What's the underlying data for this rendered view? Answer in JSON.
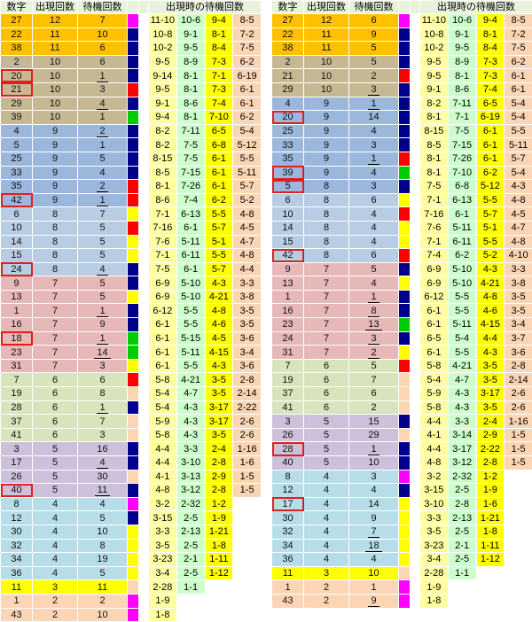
{
  "headers": [
    "数字",
    "出現回数",
    "待機回数",
    "",
    "",
    "出現時の待機回数",
    "",
    "",
    ""
  ],
  "colors": {
    "orange": "#ffc000",
    "tan": "#c5b893",
    "blue": "#9bb7dc",
    "lightblue": "#b8cce4",
    "pink": "#e6b8b7",
    "sage": "#d8e4bc",
    "lavender": "#ccc0da",
    "cyan": "#b7dee8",
    "peach": "#fcd5b4",
    "yellow": "#ffff00",
    "highlight": "#e0201b"
  },
  "left": [
    {
      "g": "orange",
      "h": false,
      "u": false,
      "b": "magenta",
      "cells": [
        "27",
        "12",
        "7",
        "11-10",
        "10-6",
        "9-4",
        "8-5"
      ]
    },
    {
      "g": "orange",
      "h": false,
      "u": false,
      "b": "navy",
      "cells": [
        "22",
        "11",
        "10",
        "10-8",
        "9-1",
        "8-1",
        "7-2"
      ]
    },
    {
      "g": "orange",
      "h": false,
      "u": false,
      "b": "navy",
      "cells": [
        "38",
        "11",
        "6",
        "10-2",
        "9-5",
        "8-4",
        "7-5"
      ]
    },
    {
      "g": "tan",
      "h": false,
      "u": false,
      "b": "navy",
      "cells": [
        "2",
        "10",
        "6",
        "9-5",
        "8-9",
        "7-3",
        "6-2"
      ]
    },
    {
      "g": "tan",
      "h": true,
      "u": true,
      "b": "navy",
      "cells": [
        "20",
        "10",
        "1",
        "9-14",
        "8-1",
        "7-1",
        "6-19"
      ]
    },
    {
      "g": "tan",
      "h": true,
      "u": false,
      "b": "red",
      "cells": [
        "21",
        "10",
        "3",
        "9-5",
        "8-1",
        "7-3",
        "6-1"
      ]
    },
    {
      "g": "tan",
      "h": false,
      "u": true,
      "b": "navy",
      "cells": [
        "29",
        "10",
        "4",
        "9-1",
        "8-6",
        "7-4",
        "6-1"
      ]
    },
    {
      "g": "tan",
      "h": false,
      "u": false,
      "b": "green",
      "cells": [
        "39",
        "10",
        "1",
        "9-4",
        "8-1",
        "7-10",
        "6-2"
      ]
    },
    {
      "g": "blue",
      "h": false,
      "u": true,
      "b": "navy",
      "cells": [
        "4",
        "9",
        "2",
        "8-2",
        "7-11",
        "6-5",
        "5-4"
      ]
    },
    {
      "g": "blue",
      "h": false,
      "u": false,
      "b": "navy",
      "cells": [
        "5",
        "9",
        "1",
        "8-2",
        "7-5",
        "6-8",
        "5-12"
      ]
    },
    {
      "g": "blue",
      "h": false,
      "u": false,
      "b": "navy",
      "cells": [
        "25",
        "9",
        "5",
        "8-15",
        "7-5",
        "6-1",
        "5-5"
      ]
    },
    {
      "g": "blue",
      "h": false,
      "u": false,
      "b": "navy",
      "cells": [
        "33",
        "9",
        "4",
        "8-5",
        "7-15",
        "6-1",
        "5-11"
      ]
    },
    {
      "g": "blue",
      "h": false,
      "u": true,
      "b": "red",
      "cells": [
        "35",
        "9",
        "2",
        "8-1",
        "7-26",
        "6-1",
        "5-7"
      ]
    },
    {
      "g": "blue",
      "h": true,
      "u": true,
      "b": "red",
      "cells": [
        "42",
        "9",
        "1",
        "8-6",
        "7-4",
        "6-2",
        "5-2"
      ]
    },
    {
      "g": "lightblue",
      "h": false,
      "u": false,
      "b": "yellow",
      "cells": [
        "6",
        "8",
        "7",
        "7-1",
        "6-13",
        "5-5",
        "4-8"
      ]
    },
    {
      "g": "lightblue",
      "h": false,
      "u": false,
      "b": "red",
      "cells": [
        "10",
        "8",
        "5",
        "7-16",
        "6-1",
        "5-7",
        "4-5"
      ]
    },
    {
      "g": "lightblue",
      "h": false,
      "u": false,
      "b": "yellow",
      "cells": [
        "14",
        "8",
        "5",
        "7-6",
        "5-11",
        "5-1",
        "4-7"
      ]
    },
    {
      "g": "lightblue",
      "h": false,
      "u": false,
      "b": "yellow",
      "cells": [
        "15",
        "8",
        "5",
        "7-1",
        "6-11",
        "5-5",
        "4-8"
      ]
    },
    {
      "g": "lightblue",
      "h": true,
      "u": true,
      "b": "navy",
      "cells": [
        "24",
        "8",
        "4",
        "7-5",
        "6-1",
        "5-7",
        "4-4"
      ]
    },
    {
      "g": "pink",
      "h": false,
      "u": false,
      "b": "navy",
      "cells": [
        "9",
        "7",
        "5",
        "6-9",
        "5-10",
        "4-3",
        "3-3"
      ]
    },
    {
      "g": "pink",
      "h": false,
      "u": false,
      "b": "yellow",
      "cells": [
        "13",
        "7",
        "5",
        "6-9",
        "5-10",
        "4-21",
        "3-8"
      ]
    },
    {
      "g": "pink",
      "h": false,
      "u": true,
      "b": "navy",
      "cells": [
        "1",
        "7",
        "1",
        "6-12",
        "5-5",
        "4-8",
        "3-5"
      ]
    },
    {
      "g": "pink",
      "h": false,
      "u": false,
      "b": "navy",
      "cells": [
        "16",
        "7",
        "9",
        "6-1",
        "5-5",
        "4-6",
        "3-5"
      ]
    },
    {
      "g": "pink",
      "h": true,
      "u": true,
      "b": "green",
      "cells": [
        "18",
        "7",
        "1",
        "6-1",
        "5-15",
        "4-5",
        "3-6"
      ]
    },
    {
      "g": "pink",
      "h": false,
      "u": true,
      "b": "green",
      "cells": [
        "23",
        "7",
        "14",
        "6-1",
        "5-11",
        "4-15",
        "3-4"
      ]
    },
    {
      "g": "pink",
      "h": false,
      "u": false,
      "b": "yellow",
      "cells": [
        "31",
        "7",
        "3",
        "6-1",
        "5-5",
        "4-3",
        "3-6"
      ]
    },
    {
      "g": "sage",
      "h": false,
      "u": false,
      "b": "red",
      "cells": [
        "7",
        "6",
        "6",
        "5-8",
        "4-21",
        "3-5",
        "2-8"
      ]
    },
    {
      "g": "sage",
      "h": false,
      "u": false,
      "b": "peach",
      "cells": [
        "19",
        "6",
        "8",
        "5-4",
        "4-7",
        "3-5",
        "2-14"
      ]
    },
    {
      "g": "sage",
      "h": false,
      "u": true,
      "b": "navy",
      "cells": [
        "28",
        "6",
        "1",
        "5-4",
        "4-3",
        "3-17",
        "2-22"
      ]
    },
    {
      "g": "sage",
      "h": false,
      "u": false,
      "b": "peach",
      "cells": [
        "37",
        "6",
        "7",
        "5-9",
        "4-3",
        "3-17",
        "2-6"
      ]
    },
    {
      "g": "sage",
      "h": false,
      "u": false,
      "b": "peach",
      "cells": [
        "41",
        "6",
        "3",
        "5-8",
        "4-3",
        "3-5",
        "2-6"
      ]
    },
    {
      "g": "lavender",
      "h": false,
      "u": false,
      "b": "navy",
      "cells": [
        "3",
        "5",
        "16",
        "4-4",
        "3-3",
        "2-4",
        "1-16"
      ]
    },
    {
      "g": "lavender",
      "h": false,
      "u": true,
      "b": "navy",
      "cells": [
        "17",
        "5",
        "4",
        "4-4",
        "3-10",
        "2-8",
        "1-6"
      ]
    },
    {
      "g": "lavender",
      "h": false,
      "u": false,
      "b": "peach",
      "cells": [
        "26",
        "5",
        "30",
        "4-1",
        "3-13",
        "2-9",
        "1-5"
      ]
    },
    {
      "g": "lavender",
      "h": true,
      "u": true,
      "b": "navy",
      "cells": [
        "40",
        "5",
        "11",
        "4-8",
        "3-12",
        "2-8",
        "1-5"
      ]
    },
    {
      "g": "cyan",
      "h": false,
      "u": false,
      "b": "magenta",
      "cells": [
        "8",
        "4",
        "4",
        "3-2",
        "2-32",
        "1-2",
        ""
      ]
    },
    {
      "g": "cyan",
      "h": false,
      "u": false,
      "b": "navy",
      "cells": [
        "12",
        "4",
        "5",
        "3-15",
        "2-5",
        "1-9",
        ""
      ]
    },
    {
      "g": "cyan",
      "h": false,
      "u": false,
      "b": "yellow",
      "cells": [
        "30",
        "4",
        "10",
        "3-3",
        "2-13",
        "1-21",
        ""
      ]
    },
    {
      "g": "cyan",
      "h": false,
      "u": false,
      "b": "yellow",
      "cells": [
        "32",
        "4",
        "8",
        "3-5",
        "2-5",
        "1-8",
        ""
      ]
    },
    {
      "g": "cyan",
      "h": false,
      "u": false,
      "b": "yellow",
      "cells": [
        "34",
        "4",
        "19",
        "3-23",
        "2-1",
        "1-11",
        ""
      ]
    },
    {
      "g": "cyan",
      "h": false,
      "u": false,
      "b": "yellow",
      "cells": [
        "36",
        "4",
        "5",
        "3-4",
        "2-5",
        "1-12",
        ""
      ]
    },
    {
      "g": "yellow",
      "h": false,
      "u": false,
      "b": "peach",
      "cells": [
        "11",
        "3",
        "11",
        "2-28",
        "1-1",
        "",
        ""
      ]
    },
    {
      "g": "peach",
      "h": false,
      "u": false,
      "b": "magenta",
      "cells": [
        "1",
        "2",
        "2",
        "1-9",
        "",
        "",
        " "
      ]
    },
    {
      "g": "peach",
      "h": false,
      "u": false,
      "b": "magenta",
      "cells": [
        "43",
        "2",
        "10",
        "1-8",
        "",
        "",
        ""
      ]
    }
  ],
  "right": [
    {
      "g": "orange",
      "h": false,
      "u": false,
      "b": "magenta",
      "cells": [
        "27",
        "12",
        "6",
        "11-10",
        "10-6",
        "9-4",
        "8-5"
      ]
    },
    {
      "g": "orange",
      "h": false,
      "u": false,
      "b": "navy",
      "cells": [
        "22",
        "11",
        "9",
        "10-8",
        "9-1",
        "8-1",
        "7-2"
      ]
    },
    {
      "g": "orange",
      "h": false,
      "u": false,
      "b": "navy",
      "cells": [
        "38",
        "11",
        "5",
        "10-2",
        "9-5",
        "8-4",
        "7-5"
      ]
    },
    {
      "g": "tan",
      "h": false,
      "u": false,
      "b": "navy",
      "cells": [
        "2",
        "10",
        "5",
        "9-5",
        "8-9",
        "7-3",
        "6-2"
      ]
    },
    {
      "g": "tan",
      "h": false,
      "u": false,
      "b": "red",
      "cells": [
        "21",
        "10",
        "2",
        "9-5",
        "8-1",
        "7-3",
        "6-1"
      ]
    },
    {
      "g": "tan",
      "h": false,
      "u": true,
      "b": "navy",
      "cells": [
        "29",
        "10",
        "3",
        "9-1",
        "8-6",
        "7-4",
        "6-1"
      ]
    },
    {
      "g": "blue",
      "h": false,
      "u": true,
      "b": "navy",
      "cells": [
        "4",
        "9",
        "1",
        "8-2",
        "7-11",
        "6-5",
        "5-4"
      ]
    },
    {
      "g": "blue",
      "h": true,
      "u": false,
      "b": "navy",
      "cells": [
        "20",
        "9",
        "14",
        "8-1",
        "7-1",
        "6-19",
        "5-4"
      ]
    },
    {
      "g": "blue",
      "h": false,
      "u": false,
      "b": "navy",
      "cells": [
        "25",
        "9",
        "4",
        "8-15",
        "7-5",
        "6-1",
        "5-5"
      ]
    },
    {
      "g": "blue",
      "h": false,
      "u": false,
      "b": "navy",
      "cells": [
        "33",
        "9",
        "3",
        "8-5",
        "7-15",
        "6-1",
        "5-11"
      ]
    },
    {
      "g": "blue",
      "h": false,
      "u": true,
      "b": "red",
      "cells": [
        "35",
        "9",
        "1",
        "8-1",
        "7-26",
        "6-1",
        "5-7"
      ]
    },
    {
      "g": "blue",
      "h": true,
      "u": false,
      "b": "green",
      "cells": [
        "39",
        "9",
        "4",
        "8-1",
        "7-10",
        "6-2",
        "5-4"
      ]
    },
    {
      "g": "blue",
      "h": true,
      "u": false,
      "b": "navy",
      "cells": [
        "5",
        "8",
        "3",
        "7-5",
        "6-8",
        "5-12",
        "4-3"
      ]
    },
    {
      "g": "lightblue",
      "h": false,
      "u": false,
      "b": "yellow",
      "cells": [
        "6",
        "8",
        "6",
        "7-1",
        "6-13",
        "5-5",
        "4-8"
      ]
    },
    {
      "g": "lightblue",
      "h": false,
      "u": false,
      "b": "red",
      "cells": [
        "10",
        "8",
        "4",
        "7-16",
        "6-1",
        "5-7",
        "4-5"
      ]
    },
    {
      "g": "lightblue",
      "h": false,
      "u": false,
      "b": "yellow",
      "cells": [
        "14",
        "8",
        "4",
        "7-6",
        "5-11",
        "5-1",
        "4-7"
      ]
    },
    {
      "g": "lightblue",
      "h": false,
      "u": false,
      "b": "yellow",
      "cells": [
        "15",
        "8",
        "4",
        "7-1",
        "6-11",
        "5-5",
        "4-8"
      ]
    },
    {
      "g": "lightblue",
      "h": true,
      "u": false,
      "b": "red",
      "cells": [
        "42",
        "8",
        "6",
        "7-4",
        "6-2",
        "5-2",
        "4-10"
      ]
    },
    {
      "g": "pink",
      "h": false,
      "u": false,
      "b": "navy",
      "cells": [
        "9",
        "7",
        "5",
        "6-9",
        "5-10",
        "4-3",
        "3-3"
      ]
    },
    {
      "g": "pink",
      "h": false,
      "u": false,
      "b": "yellow",
      "cells": [
        "13",
        "7",
        "4",
        "6-9",
        "5-10",
        "4-21",
        "3-8"
      ]
    },
    {
      "g": "pink",
      "h": false,
      "u": true,
      "b": "navy",
      "cells": [
        "1",
        "7",
        "1",
        "6-12",
        "5-5",
        "4-8",
        "3-5"
      ]
    },
    {
      "g": "pink",
      "h": false,
      "u": true,
      "b": "navy",
      "cells": [
        "16",
        "7",
        "8",
        "6-1",
        "5-5",
        "4-6",
        "3-5"
      ]
    },
    {
      "g": "pink",
      "h": false,
      "u": true,
      "b": "green",
      "cells": [
        "23",
        "7",
        "13",
        "6-1",
        "5-11",
        "4-15",
        "3-4"
      ]
    },
    {
      "g": "pink",
      "h": false,
      "u": true,
      "b": "navy",
      "cells": [
        "24",
        "7",
        "3",
        "6-5",
        "5-4",
        "4-4",
        "3-7"
      ]
    },
    {
      "g": "pink",
      "h": false,
      "u": true,
      "b": "yellow",
      "cells": [
        "31",
        "7",
        "2",
        "6-1",
        "5-5",
        "4-3",
        "3-6"
      ]
    },
    {
      "g": "sage",
      "h": false,
      "u": false,
      "b": "red",
      "cells": [
        "7",
        "6",
        "5",
        "5-8",
        "4-21",
        "3-5",
        "2-8"
      ]
    },
    {
      "g": "sage",
      "h": false,
      "u": false,
      "b": "peach",
      "cells": [
        "19",
        "6",
        "7",
        "5-4",
        "4-7",
        "3-5",
        "2-14"
      ]
    },
    {
      "g": "sage",
      "h": false,
      "u": false,
      "b": "peach",
      "cells": [
        "37",
        "6",
        "6",
        "5-9",
        "4-3",
        "3-17",
        "2-6"
      ]
    },
    {
      "g": "sage",
      "h": false,
      "u": false,
      "b": "peach",
      "cells": [
        "41",
        "6",
        "2",
        "5-8",
        "4-3",
        "3-5",
        "2-6"
      ]
    },
    {
      "g": "lavender",
      "h": false,
      "u": false,
      "b": "navy",
      "cells": [
        "3",
        "5",
        "15",
        "4-4",
        "3-3",
        "2-4",
        "1-16"
      ]
    },
    {
      "g": "lavender",
      "h": false,
      "u": false,
      "b": "peach",
      "cells": [
        "26",
        "5",
        "29",
        "4-1",
        "3-14",
        "2-9",
        "1-5"
      ]
    },
    {
      "g": "lavender",
      "h": true,
      "u": true,
      "b": "navy",
      "cells": [
        "28",
        "5",
        "1",
        "4-4",
        "3-17",
        "2-22",
        "1-5"
      ]
    },
    {
      "g": "lavender",
      "h": false,
      "u": false,
      "b": "navy",
      "cells": [
        "40",
        "5",
        "10",
        "4-8",
        "3-12",
        "2-8",
        "1-5"
      ]
    },
    {
      "g": "cyan",
      "h": false,
      "u": false,
      "b": "magenta",
      "cells": [
        "8",
        "4",
        "3",
        "3-2",
        "2-32",
        "1-2",
        ""
      ]
    },
    {
      "g": "cyan",
      "h": false,
      "u": false,
      "b": "navy",
      "cells": [
        "12",
        "4",
        "4",
        "3-15",
        "2-5",
        "1-9",
        ""
      ]
    },
    {
      "g": "cyan",
      "h": true,
      "u": false,
      "b": "yellow",
      "cells": [
        "17",
        "4",
        "14",
        "3-10",
        "2-8",
        "1-6",
        ""
      ]
    },
    {
      "g": "cyan",
      "h": false,
      "u": false,
      "b": "yellow",
      "cells": [
        "30",
        "4",
        "9",
        "3-3",
        "2-13",
        "1-21",
        ""
      ]
    },
    {
      "g": "cyan",
      "h": false,
      "u": true,
      "b": "yellow",
      "cells": [
        "32",
        "4",
        "7",
        "3-5",
        "2-5",
        "1-8",
        ""
      ]
    },
    {
      "g": "cyan",
      "h": false,
      "u": true,
      "b": "yellow",
      "cells": [
        "34",
        "4",
        "18",
        "3-23",
        "2-1",
        "1-11",
        ""
      ]
    },
    {
      "g": "cyan",
      "h": false,
      "u": false,
      "b": "yellow",
      "cells": [
        "36",
        "4",
        "4",
        "3-4",
        "2-5",
        "1-12",
        ""
      ]
    },
    {
      "g": "yellow",
      "h": false,
      "u": false,
      "b": "peach",
      "cells": [
        "11",
        "3",
        "10",
        "2-28",
        "1-1",
        "",
        ""
      ]
    },
    {
      "g": "peach",
      "h": false,
      "u": false,
      "b": "magenta",
      "cells": [
        "1",
        "2",
        "1",
        "1-9",
        "",
        "",
        ""
      ]
    },
    {
      "g": "peach",
      "h": false,
      "u": true,
      "b": "magenta",
      "cells": [
        "43",
        "2",
        "9",
        "1-8",
        "",
        "",
        ""
      ]
    }
  ]
}
